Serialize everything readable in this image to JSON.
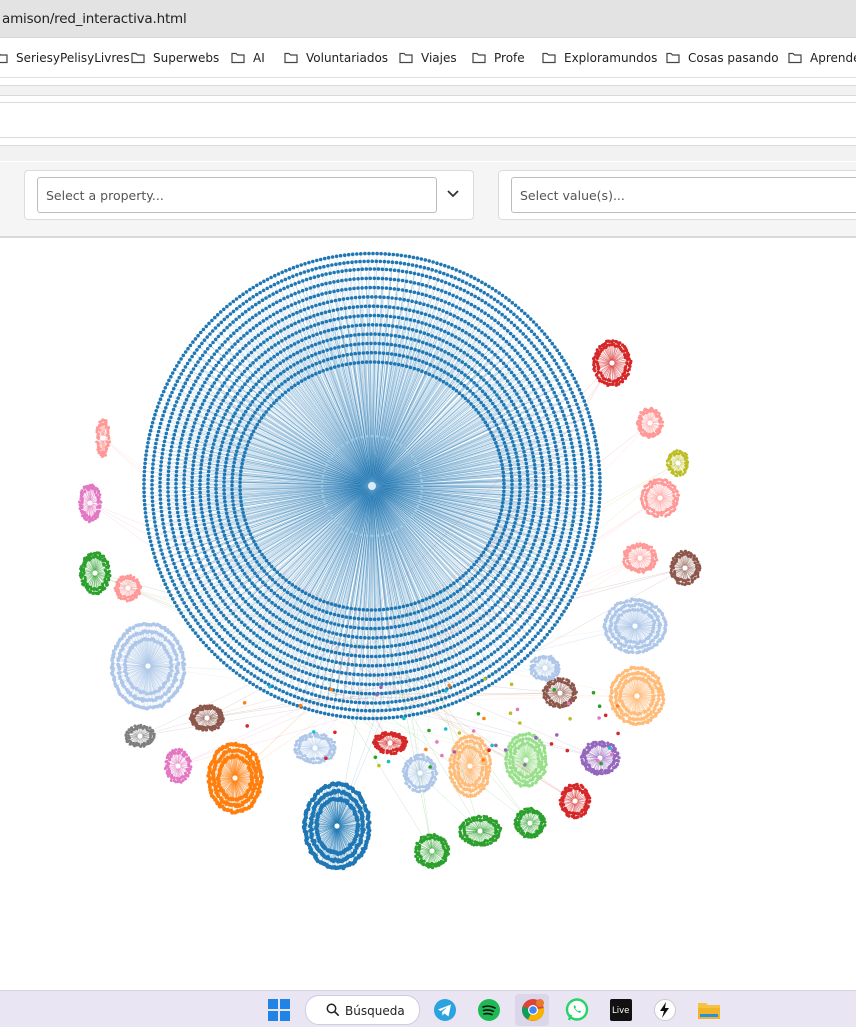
{
  "browser": {
    "address": "amison/red_interactiva.html",
    "bookmarks": [
      {
        "label": "SeriesyPelisyLivres"
      },
      {
        "label": "Superwebs"
      },
      {
        "label": "AI"
      },
      {
        "label": "Voluntariados"
      },
      {
        "label": "Viajes"
      },
      {
        "label": "Profe"
      },
      {
        "label": "Exploramundos"
      },
      {
        "label": "Cosas pasando"
      },
      {
        "label": "Aprende"
      }
    ]
  },
  "filters": {
    "property_placeholder": "Select a property...",
    "value_placeholder": "Select value(s)..."
  },
  "graph": {
    "description_colors": {
      "hub": "#1f77b4",
      "orange": "#ff7f0e",
      "green": "#2ca02c",
      "red": "#d62728",
      "purple": "#9467bd",
      "brown": "#8c564b",
      "pink": "#e377c2",
      "gray": "#7f7f7f",
      "olive": "#bcbd22",
      "cyan": "#17becf",
      "lightblue": "#aec7e8",
      "lightorange": "#ffbb78",
      "lightgreen": "#98df8a",
      "lightred": "#ff9896"
    }
  },
  "taskbar": {
    "search_label": "Búsqueda",
    "icons": [
      "windows-start-icon",
      "search-icon",
      "telegram-icon",
      "spotify-icon",
      "chrome-icon",
      "whatsapp-icon",
      "live-icon",
      "app-icon",
      "file-explorer-icon"
    ],
    "live_text": "Live"
  }
}
